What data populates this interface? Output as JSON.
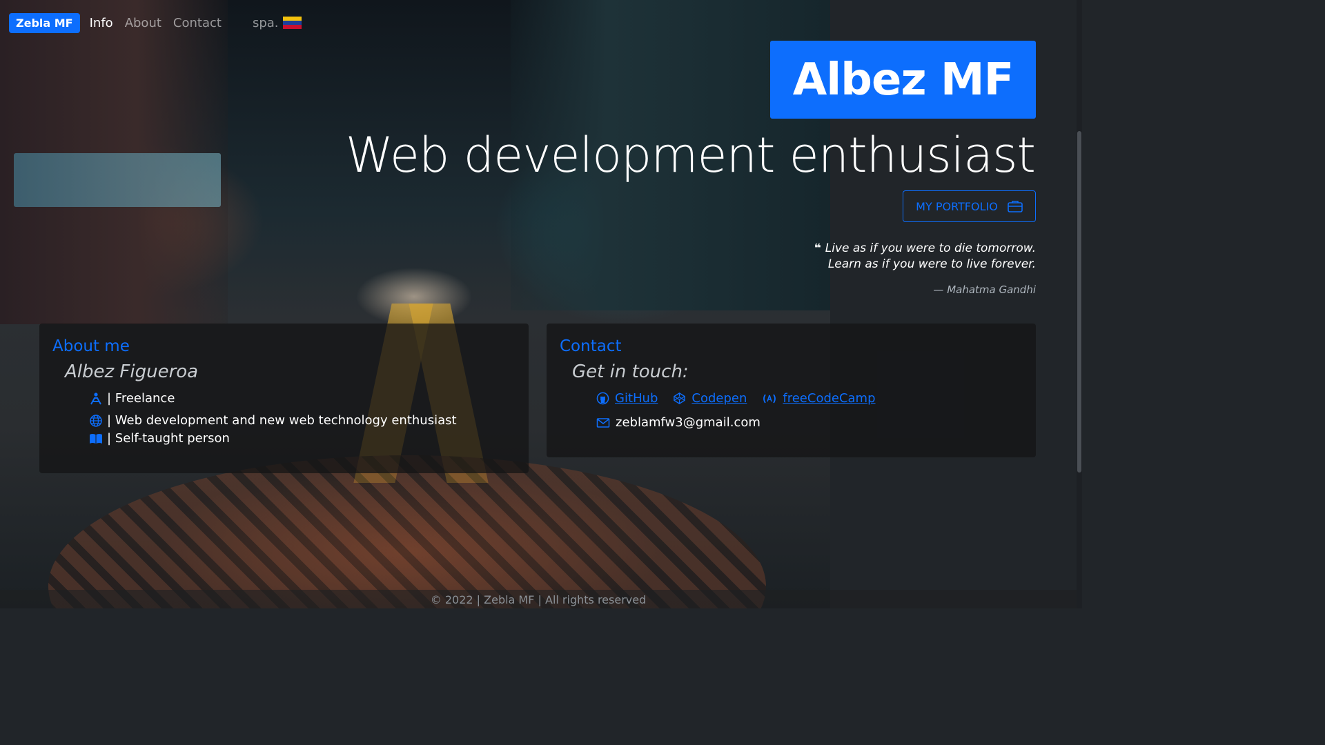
{
  "nav": {
    "brand": "Zebla MF",
    "links": [
      "Info",
      "About",
      "Contact"
    ],
    "lang": "spa.",
    "flag_colors": [
      "#f4c20d",
      "#1d3f9a",
      "#c8102e"
    ]
  },
  "hero": {
    "title": "Albez MF",
    "subtitle": "Web development enthusiast",
    "portfolio_label": "MY PORTFOLIO",
    "quote_line1": "Live as if you were to die tomorrow.",
    "quote_line2": "Learn as if you were to live forever.",
    "quote_author": "— Mahatma Gandhi"
  },
  "about": {
    "title": "About me",
    "name": "Albez Figueroa",
    "items": [
      {
        "icon": "person-workspace-icon",
        "text": "| Freelance"
      },
      {
        "icon": "globe-icon",
        "text": "| Web development and new web technology enthusiast"
      },
      {
        "icon": "book-icon",
        "text": "| Self-taught person"
      }
    ]
  },
  "contact": {
    "title": "Contact",
    "subtitle": "Get in touch:",
    "links": [
      {
        "icon": "github-icon",
        "label": "GitHub"
      },
      {
        "icon": "codepen-icon",
        "label": "Codepen"
      },
      {
        "icon": "freecodecamp-icon",
        "label": "freeCodeCamp"
      }
    ],
    "email_icon": "envelope-icon",
    "email": "zeblamfw3@gmail.com"
  },
  "footer": {
    "text": "© 2022 | Zebla MF | All rights reserved"
  },
  "colors": {
    "primary": "#0d6efd",
    "panel": "#212529"
  }
}
